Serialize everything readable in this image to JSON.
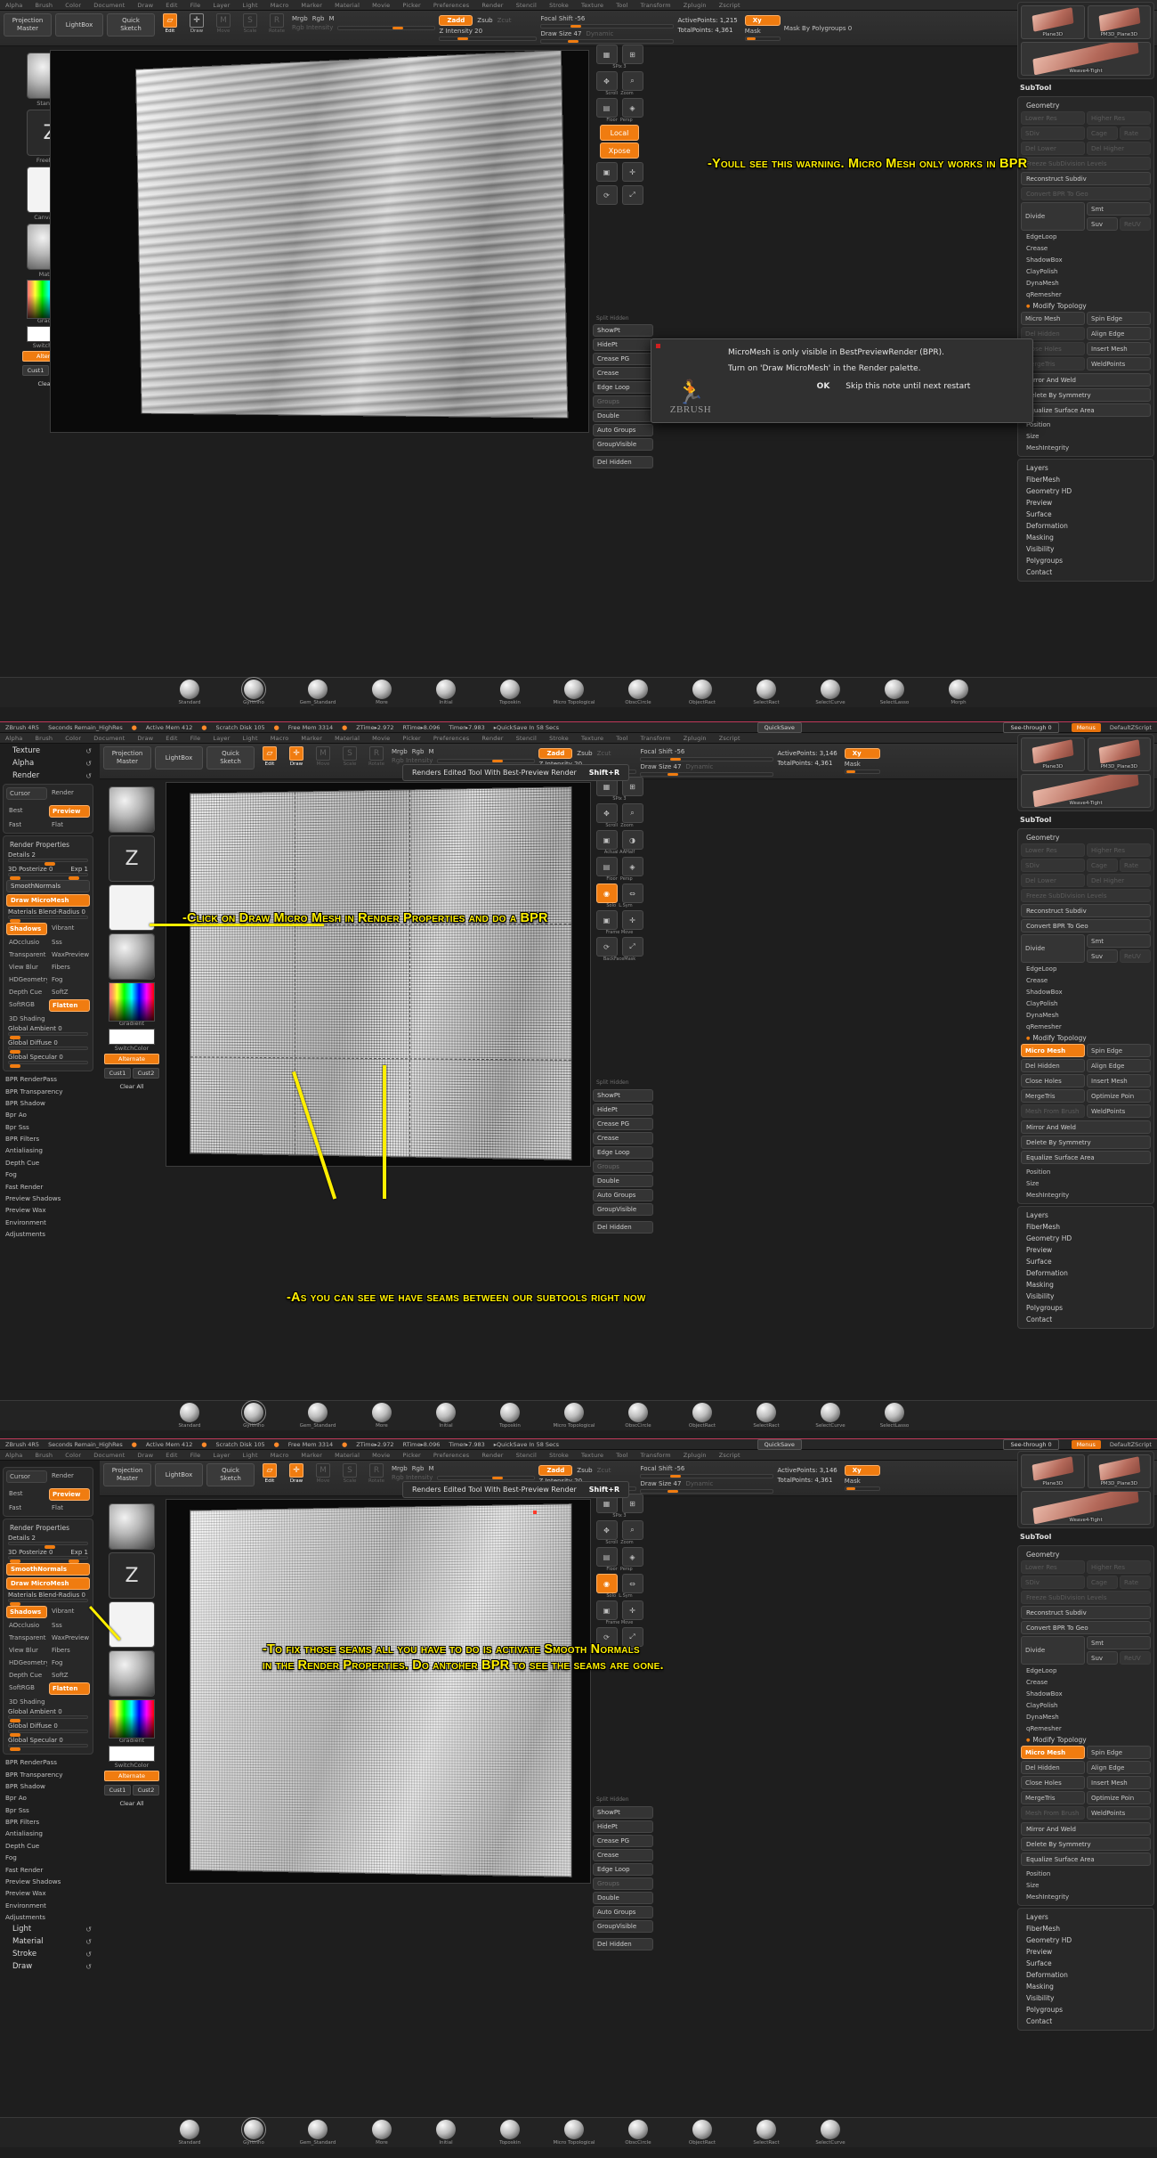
{
  "app": {
    "name": "ZBrush 4R5"
  },
  "menubar": [
    "Alpha",
    "Brush",
    "Color",
    "Document",
    "Draw",
    "Edit",
    "File",
    "Layer",
    "Light",
    "Macro",
    "Marker",
    "Material",
    "Movie",
    "Picker",
    "Preferences",
    "Render",
    "Stencil",
    "Stroke",
    "Texture",
    "Tool",
    "Transform",
    "Zplugin",
    "Zscript"
  ],
  "statusbar": {
    "app": "ZBrush 4R5",
    "seconds": "Seconds Remain_HighRes",
    "active_mem": "Active Mem 412",
    "scratch_disk": "Scratch Disk 105",
    "free_mem": "Free Mem 3314",
    "ztime": "ZTime▸2.972",
    "rtime": "RTime▸8.096",
    "timer": "Timer▸7.983",
    "quicksave": "▸QuickSave In 58 Secs",
    "quicksave_btn": "QuickSave",
    "seethrough": "See-through 0",
    "menus_btn": "Menus",
    "default_zscript": "DefaultZScript"
  },
  "toolbar": {
    "projection_master": "Projection\nMaster",
    "lightbox": "LightBox",
    "quick_sketch": "Quick\nSketch",
    "edit": "Edit",
    "draw": "Draw",
    "move": "Move",
    "scale": "Scale",
    "rotate": "Rotate",
    "mrgb": "Mrgb",
    "rgb": "Rgb",
    "m": "M",
    "rgb_intensity": "Rgb Intensity",
    "intensity_label": "Intensity",
    "zadd": "Zadd",
    "zsub": "Zsub",
    "zcut": "Zcut",
    "z_intensity": "Z Intensity 20",
    "focal_shift": "Focal Shift -56",
    "draw_size": "Draw Size 47",
    "dynamic": "Dynamic",
    "active_points_p1": "ActivePoints: 1,215",
    "total_points_p1": "TotalPoints: 4,361",
    "active_points_p2": "ActivePoints: 3,146",
    "total_points_p2": "TotalPoints: 4,361",
    "xy": "Xy",
    "mask": "Mask By Polygroups 0",
    "mask_short": "Mask"
  },
  "leftshelf": {
    "rows": [
      {
        "label": "Texture",
        "icon": "reset-icon"
      },
      {
        "label": "Alpha",
        "icon": "reset-icon"
      },
      {
        "label": "Render",
        "icon": "reset-icon"
      },
      {
        "label": "Stroke",
        "icon": "reset-icon"
      },
      {
        "label": "Draw",
        "icon": "reset-icon"
      },
      {
        "label": "Material",
        "icon": "reset-icon"
      },
      {
        "label": "Light",
        "icon": "reset-icon"
      }
    ],
    "canvas_off": "Canvas Off",
    "gradient": "Gradient",
    "switchcolor": "SwitchColor",
    "alternate": "Alternate",
    "cust1": "Cust1",
    "cust2": "Cust2",
    "clear_all": "Clear All"
  },
  "render_palette": {
    "title": "Render",
    "cursor": "Cursor",
    "render": "Render",
    "best": "Best",
    "preview": "Preview",
    "fast": "Fast",
    "flat": "Flat",
    "properties_title": "Render Properties",
    "details": "Details 2",
    "posterize": "3D Posterize 0",
    "exp": "Exp 1",
    "smooth_normals": "SmoothNormals",
    "draw_micromesh": "Draw MicroMesh",
    "materials_blend": "Materials Blend-Radius 0",
    "shadows": "Shadows",
    "vibrant": "Vibrant",
    "aocclusion": "AOcclusio",
    "sss": "Sss",
    "transparent": "Transparent",
    "waxpreview": "WaxPreview",
    "view_blur": "View Blur",
    "fibers": "Fibers",
    "hdgeometry": "HDGeometry",
    "fog": "Fog",
    "depth_cue": "Depth Cue",
    "softz": "SoftZ",
    "softrgb": "SoftRGB",
    "flatten": "Flatten",
    "shading_3d": "3D Shading 10",
    "global_ambient": "Global Ambient 0",
    "global_diffuse": "Global Diffuse 0",
    "global_specular": "Global Specular 0",
    "sections": [
      "BPR RenderPass",
      "BPR Transparency",
      "BPR Shadow",
      "Bpr Ao",
      "Bpr Sss",
      "BPR Filters",
      "Antialiasing",
      "Depth Cue",
      "Fog",
      "Fast Render",
      "Preview Shadows",
      "Preview Wax",
      "Environment",
      "Adjustments"
    ]
  },
  "rightshelf": {
    "items": [
      {
        "label": "SPix",
        "value": "3"
      },
      {
        "label": "Scroll"
      },
      {
        "label": "Zoom"
      },
      {
        "label": "Actual"
      },
      {
        "label": "AAHalf"
      },
      {
        "label": "Floor"
      },
      {
        "label": "Persp"
      },
      {
        "label": "Local"
      },
      {
        "label": "Xpose"
      },
      {
        "label": "Solo"
      },
      {
        "label": "L.Sym"
      },
      {
        "label": "Frame"
      },
      {
        "label": "Move"
      },
      {
        "label": "Swap"
      },
      {
        "label": "Rotate"
      },
      {
        "label": "Scale"
      },
      {
        "label": "BackfaceMask"
      }
    ],
    "split_hidden": "Split Hidden",
    "showpt": "ShowPt",
    "hidept": "HidePt",
    "crease_pg": "Crease PG",
    "crease": "Crease",
    "edge_loop": "Edge Loop",
    "groups": "Groups",
    "double": "Double",
    "auto_groups": "Auto Groups",
    "group_visible": "GroupVisible",
    "del_hidden": "Del Hidden"
  },
  "tool_palette": {
    "thumbs": [
      {
        "label": "Plane3D"
      },
      {
        "label": "PM3D_Plane3D"
      },
      {
        "label": "Weave4-Tight"
      }
    ],
    "subtool": "SubTool",
    "geometry": "Geometry",
    "lower_res": "Lower Res",
    "higher_res": "Higher Res",
    "sdiv": "SDiv",
    "cage": "Cage",
    "rate": "Rate",
    "del_lower": "Del Lower",
    "del_higher": "Del Higher",
    "freeze_subdiv": "Freeze SubDivision Levels",
    "reconstruct_subdiv": "Reconstruct Subdiv",
    "convert_bpr": "Convert BPR To Geo",
    "divide": "Divide",
    "smt": "Smt",
    "suv": "Suv",
    "reuv": "ReUV",
    "edgeloop": "EdgeLoop",
    "crease": "Crease",
    "shadowbox": "ShadowBox",
    "claypolish": "ClayPolish",
    "dynamesh": "DynaMesh",
    "qremesher": "qRemesher",
    "modify_topology": "Modify Topology",
    "micro_mesh": "Micro Mesh",
    "spin_edge": "Spin Edge",
    "align_edge": "Align Edge",
    "del_hidden": "Del Hidden",
    "insert_mesh": "Insert Mesh",
    "close_holes": "Close Holes",
    "optimize_points": "Optimize Poin",
    "mergetris": "MergeTris",
    "weldpoints": "WeldPoints",
    "mesh_from_brush": "Mesh From Brush",
    "mirror_and_weld": "Mirror And Weld",
    "delete_by_symmetry": "Delete By Symmetry",
    "equalize_surface": "Equalize Surface Area",
    "position": "Position",
    "size": "Size",
    "meshintegrity": "MeshIntegrity",
    "sections": [
      "Layers",
      "FiberMesh",
      "Geometry HD",
      "Preview",
      "Surface",
      "Deformation",
      "Masking",
      "Visibility",
      "Polygroups",
      "Contact"
    ]
  },
  "dialog": {
    "line1": "MicroMesh is only visible in BestPreviewRender (BPR).",
    "line2": "Turn on 'Draw MicroMesh' in the Render palette.",
    "ok": "OK",
    "skip": "Skip this note until next restart",
    "brand": "Brush",
    "brand_z": "Z"
  },
  "tooltip": {
    "text": "Renders Edited Tool With Best-Preview Render",
    "shortcut": "Shift+R"
  },
  "annotations": {
    "panel1": "-Youll see this warning. Micro Mesh only works in BPR",
    "panel2_a": "-Click on Draw Micro Mesh in Render Properties and do a BPR",
    "panel2_b": "-As you can see we have seams between our subtools right now",
    "panel3": "-To fix those seams all you have to do is activate Smooth Normals\nin the Render Properties. Do antoher BPR to see the seams are gone."
  },
  "bottomshelf": {
    "items": [
      "Standard",
      "Gyrtinho",
      "Gem_Standard",
      "More",
      "Initial",
      "Toposkin",
      "Micro Topological",
      "ObscCircle",
      "ObscCircle",
      "ObjectRact",
      "SelectRact",
      "SelectCurve",
      "SelectLasso",
      "Morph"
    ]
  },
  "colors": {
    "accent": "#f07c10",
    "annotation": "#ffef00",
    "panel_bg": "#1e1e1e",
    "status_line": "#c0395a"
  }
}
